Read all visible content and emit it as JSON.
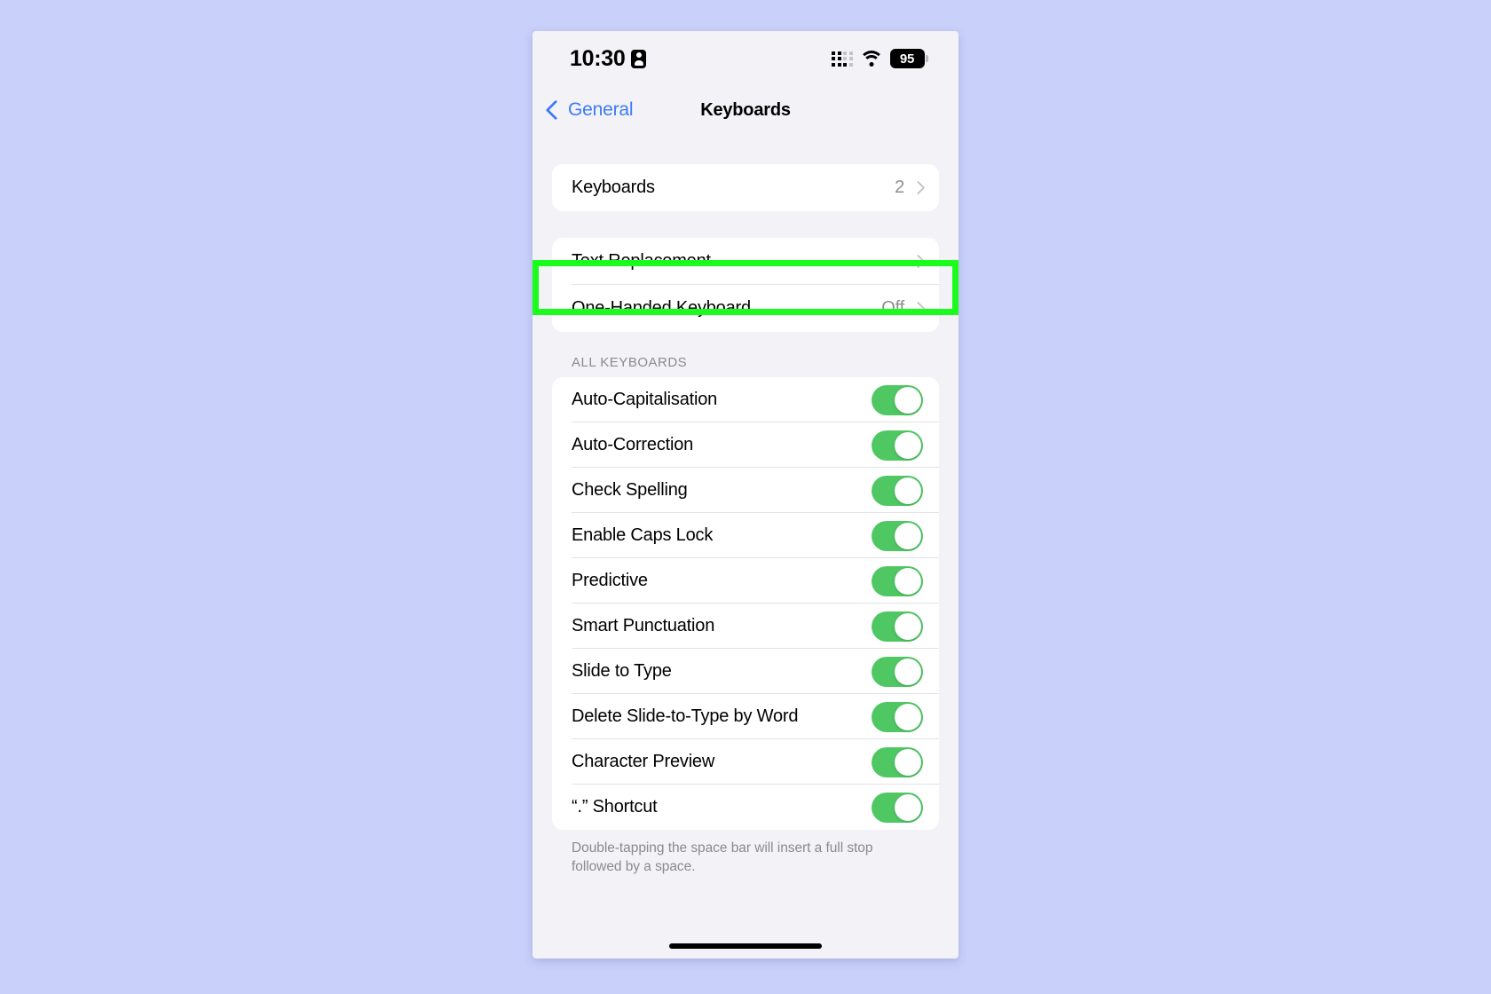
{
  "theme": {
    "page_background": "#c9d0fa",
    "screen_background": "#f2f2f7",
    "card_background": "#ffffff",
    "accent_blue": "#3d7cf4",
    "toggle_green": "#4fc863",
    "highlight_green": "#1cfc1c",
    "secondary_text": "#8e8e93"
  },
  "status_bar": {
    "time": "10:30",
    "lock_icon": "id-card-icon",
    "cellular_icon": "cellular-matrix-icon",
    "wifi_icon": "wifi-icon",
    "battery_level": "95",
    "battery_icon": "battery-icon"
  },
  "nav": {
    "back_label": "General",
    "back_icon": "chevron-left-icon",
    "title": "Keyboards"
  },
  "groups": {
    "keyboards": {
      "rows": [
        {
          "label": "Keyboards",
          "value": "2",
          "chevron": true
        }
      ]
    },
    "replacement": {
      "highlighted": true,
      "rows": [
        {
          "label": "Text Replacement",
          "value": "",
          "chevron": true
        },
        {
          "label": "One-Handed Keyboard",
          "value": "Off",
          "chevron": true
        }
      ]
    },
    "all_keyboards": {
      "header": "ALL KEYBOARDS",
      "rows": [
        {
          "label": "Auto-Capitalisation",
          "toggle": "on"
        },
        {
          "label": "Auto-Correction",
          "toggle": "on"
        },
        {
          "label": "Check Spelling",
          "toggle": "on"
        },
        {
          "label": "Enable Caps Lock",
          "toggle": "on"
        },
        {
          "label": "Predictive",
          "toggle": "on"
        },
        {
          "label": "Smart Punctuation",
          "toggle": "on"
        },
        {
          "label": "Slide to Type",
          "toggle": "on"
        },
        {
          "label": "Delete Slide-to-Type by Word",
          "toggle": "on"
        },
        {
          "label": "Character Preview",
          "toggle": "on"
        },
        {
          "label": "“.” Shortcut",
          "toggle": "on"
        }
      ],
      "footer": "Double-tapping the space bar will insert a full stop followed by a space."
    }
  }
}
